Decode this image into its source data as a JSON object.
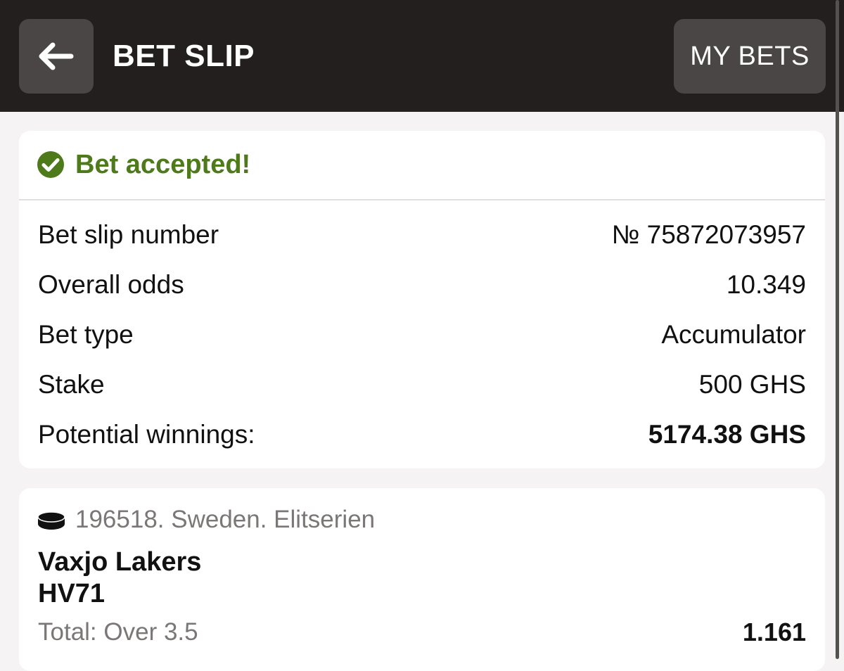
{
  "header": {
    "title": "BET SLIP",
    "my_bets_label": "MY BETS"
  },
  "status": {
    "text": "Bet accepted!",
    "color": "#4e7a1b"
  },
  "summary": [
    {
      "label": "Bet slip number",
      "value": "№ 75872073957"
    },
    {
      "label": "Overall odds",
      "value": "10.349"
    },
    {
      "label": "Bet type",
      "value": "Accumulator"
    },
    {
      "label": "Stake",
      "value": "500 GHS"
    },
    {
      "label": "Potential winnings:",
      "value": "5174.38 GHS"
    }
  ],
  "event": {
    "sport_icon": "hockey-puck-icon",
    "league": "196518. Sweden. Elitserien",
    "team_home": "Vaxjo Lakers",
    "team_away": "HV71",
    "market": "Total: Over 3.5",
    "odds": "1.161"
  },
  "colors": {
    "header_bg": "#231f1e",
    "button_bg": "#4a4645",
    "accent_green": "#4e7a1b"
  }
}
